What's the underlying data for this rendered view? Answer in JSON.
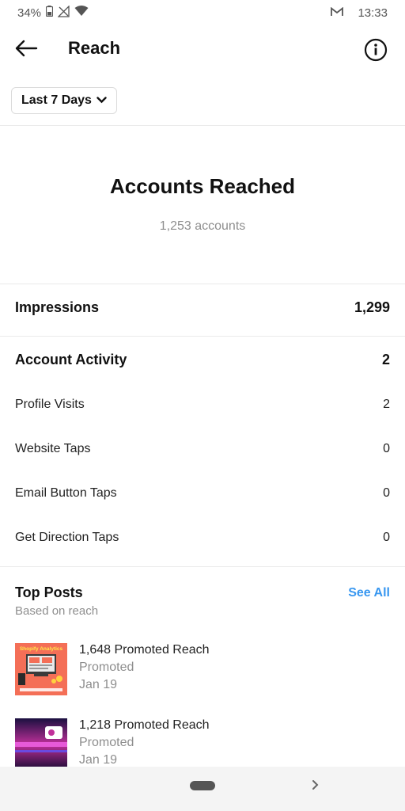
{
  "status": {
    "battery": "34%",
    "time": "13:33"
  },
  "header": {
    "title": "Reach"
  },
  "filter": {
    "label": "Last 7 Days"
  },
  "reach": {
    "title": "Accounts Reached",
    "subtitle": "1,253 accounts"
  },
  "impressions": {
    "label": "Impressions",
    "value": "1,299"
  },
  "activity": {
    "label": "Account Activity",
    "value": "2",
    "items": [
      {
        "label": "Profile Visits",
        "value": "2"
      },
      {
        "label": "Website Taps",
        "value": "0"
      },
      {
        "label": "Email Button Taps",
        "value": "0"
      },
      {
        "label": "Get Direction Taps",
        "value": "0"
      }
    ]
  },
  "top_posts": {
    "title": "Top Posts",
    "subtitle": "Based on reach",
    "see_all": "See All",
    "posts": [
      {
        "reach": "1,648 Promoted Reach",
        "label": "Promoted",
        "date": "Jan 19",
        "thumb_text": "Shopify Analytics"
      },
      {
        "reach": "1,218 Promoted Reach",
        "label": "Promoted",
        "date": "Jan 19"
      }
    ]
  }
}
